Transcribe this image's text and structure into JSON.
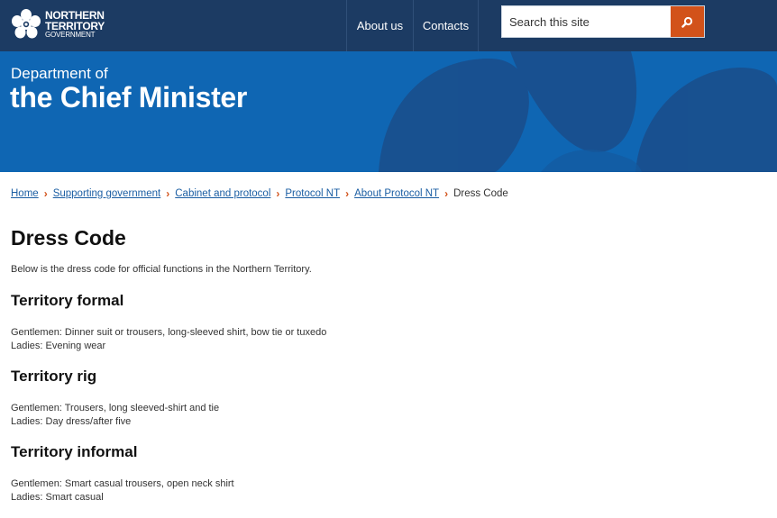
{
  "header": {
    "logo": {
      "line1": "NORTHERN",
      "line2": "TERRITORY",
      "line3": "GOVERNMENT"
    },
    "nav": [
      {
        "label": "About us"
      },
      {
        "label": "Contacts"
      }
    ],
    "search": {
      "placeholder": "Search this site",
      "value": ""
    }
  },
  "banner": {
    "subtitle": "Department of",
    "title": "the Chief Minister"
  },
  "breadcrumb": {
    "links": [
      "Home",
      "Supporting government",
      "Cabinet and protocol",
      "Protocol NT",
      "About Protocol NT"
    ],
    "current": "Dress Code"
  },
  "content": {
    "title": "Dress Code",
    "intro": "Below is the dress code for official functions in the Northern Territory.",
    "sections": [
      {
        "heading": "Territory formal",
        "gentlemen": "Gentlemen: Dinner suit or trousers, long-sleeved shirt, bow tie or tuxedo",
        "ladies": "Ladies: Evening wear"
      },
      {
        "heading": "Territory rig",
        "gentlemen": "Gentlemen: Trousers, long sleeved-shirt and tie",
        "ladies": "Ladies: Day dress/after five"
      },
      {
        "heading": "Territory informal",
        "gentlemen": "Gentlemen: Smart casual trousers, open neck shirt",
        "ladies": "Ladies: Smart casual"
      }
    ]
  },
  "colors": {
    "topbar": "#1c3b63",
    "banner": "#0f66b3",
    "accent": "#d2521a",
    "link": "#1b5ea3"
  },
  "icons": {
    "logo": "desert-rose-logo-icon",
    "search": "search-icon",
    "separator": "chevron-right-icon"
  }
}
